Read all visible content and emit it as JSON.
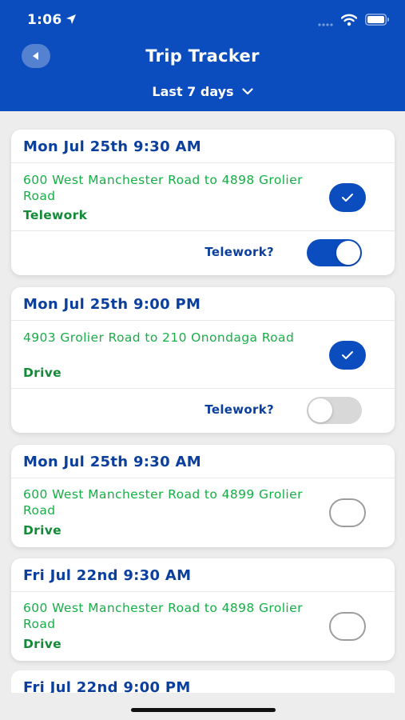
{
  "status_bar": {
    "time": "1:06"
  },
  "header": {
    "title": "Trip Tracker",
    "period": "Last 7 days"
  },
  "trips": [
    {
      "date": "Mon Jul 25th 9:30 AM",
      "route": "600 West Manchester Road to 4898 Grolier Road",
      "mode": "Telework",
      "checked": true,
      "telework_label": "Telework?",
      "telework_on": true
    },
    {
      "date": "Mon Jul 25th 9:00 PM",
      "route": "4903 Grolier Road to 210 Onondaga Road",
      "mode": "Drive",
      "checked": true,
      "telework_label": "Telework?",
      "telework_on": false
    },
    {
      "date": "Mon Jul 25th 9:30 AM",
      "route": "600 West Manchester Road to 4899 Grolier Road",
      "mode": "Drive",
      "checked": false
    },
    {
      "date": "Fri Jul 22nd 9:30 AM",
      "route": "600 West Manchester Road to 4898 Grolier Road",
      "mode": "Drive",
      "checked": false
    },
    {
      "date": "Fri Jul 22nd 9:00 PM"
    }
  ],
  "colors": {
    "brand_blue": "#0b4dbe",
    "route_green": "#15b045",
    "mode_green": "#128a36"
  }
}
